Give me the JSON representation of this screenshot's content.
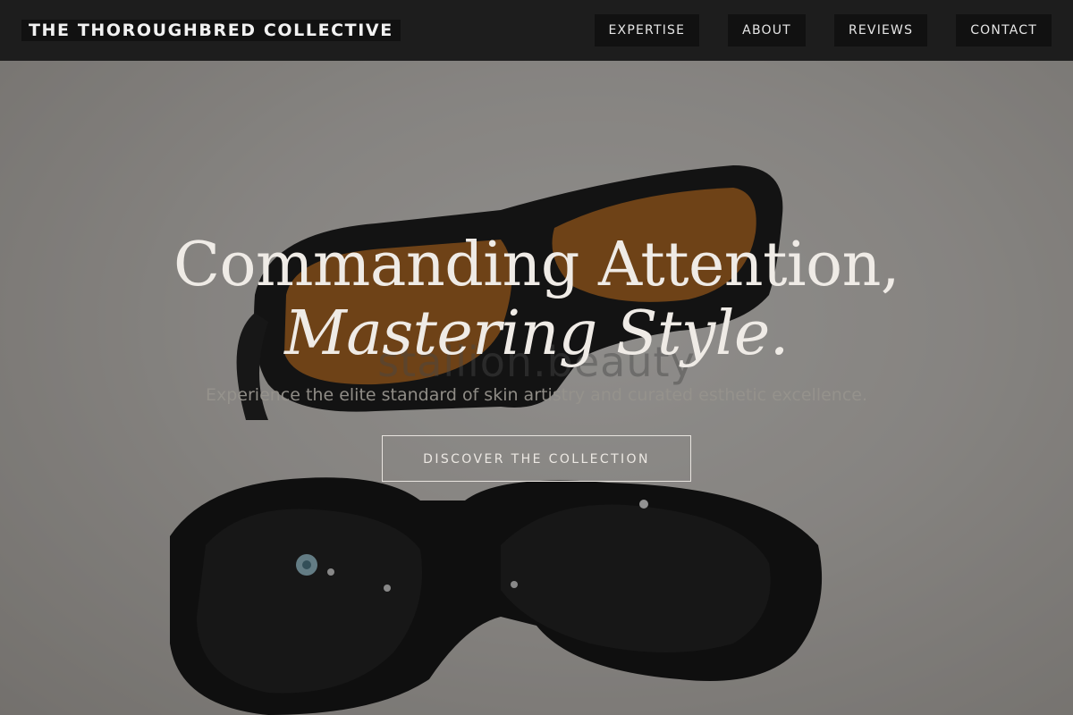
{
  "header": {
    "brand": "THE THOROUGHBRED COLLECTIVE",
    "nav": [
      {
        "label": "EXPERTISE"
      },
      {
        "label": "ABOUT"
      },
      {
        "label": "REVIEWS"
      },
      {
        "label": "CONTACT"
      }
    ]
  },
  "hero": {
    "headline_line1": "Commanding Attention,",
    "headline_line2": "Mastering Style.",
    "watermark": "stallion.beauty",
    "subtitle": "Experience the elite standard of skin artistry and curated esthetic excellence.",
    "cta_label": "DISCOVER THE COLLECTION",
    "background_image": "laser-safety-glasses-photo"
  },
  "colors": {
    "header_bg": "#1d1d1d",
    "nav_item_bg": "#111111",
    "headline": "#efebe6",
    "lens_amber": "#b0651a"
  }
}
